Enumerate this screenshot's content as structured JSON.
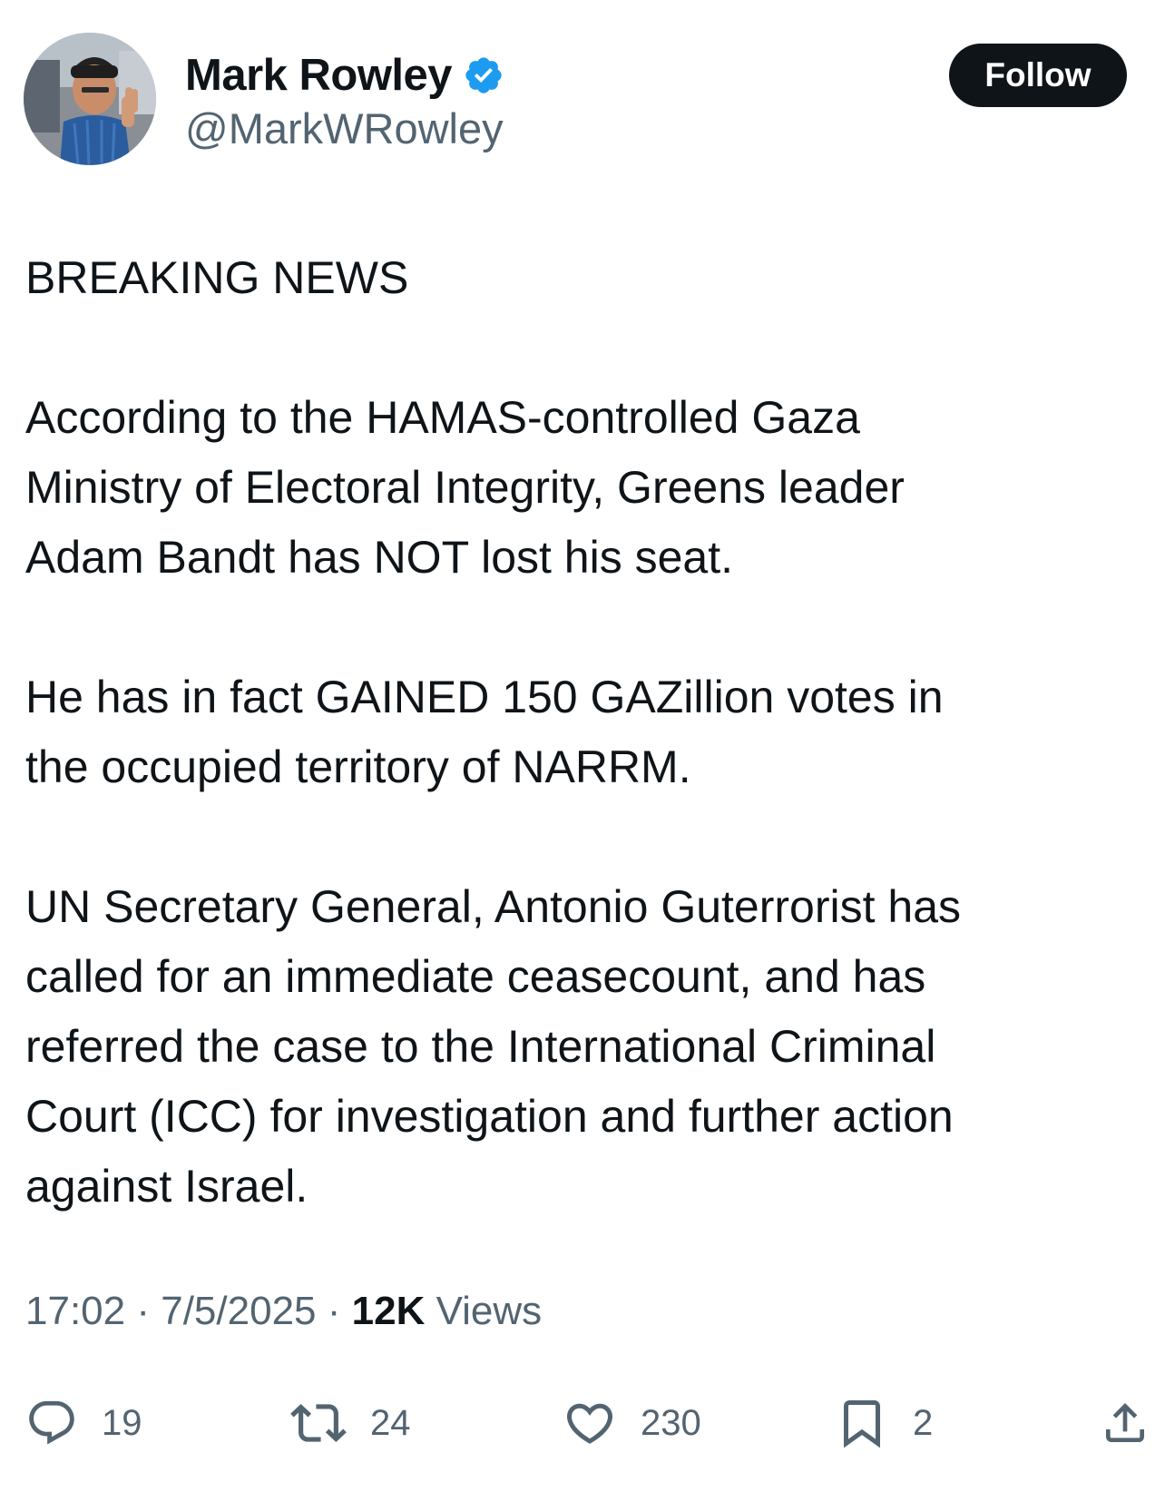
{
  "author": {
    "display_name": "Mark Rowley",
    "handle": "@MarkWRowley",
    "verified": true
  },
  "follow_label": "Follow",
  "tweet": {
    "paragraphs": [
      "BREAKING NEWS",
      "According to the HAMAS-controlled Gaza\nMinistry of Electoral Integrity, Greens leader\nAdam Bandt has NOT lost his seat.",
      "He has in fact GAINED 150 GAZillion votes in\nthe occupied territory of NARRM.",
      "UN Secretary General, Antonio Guterrorist has\ncalled for an immediate ceasecount, and has\nreferred the case to the International Criminal\nCourt (ICC) for investigation and further action\nagainst Israel."
    ]
  },
  "meta": {
    "time": "17:02",
    "separator": "·",
    "date": "7/5/2025",
    "views_count": "12K",
    "views_label": "Views"
  },
  "actions": {
    "replies": "19",
    "retweets": "24",
    "likes": "230",
    "bookmarks": "2"
  },
  "colors": {
    "text_primary": "#0f1419",
    "text_secondary": "#536471",
    "verified_blue": "#1d9bf0",
    "follow_bg": "#0f1419"
  },
  "icons": [
    "verified-badge-icon",
    "reply-icon",
    "retweet-icon",
    "like-icon",
    "bookmark-icon",
    "share-icon"
  ]
}
